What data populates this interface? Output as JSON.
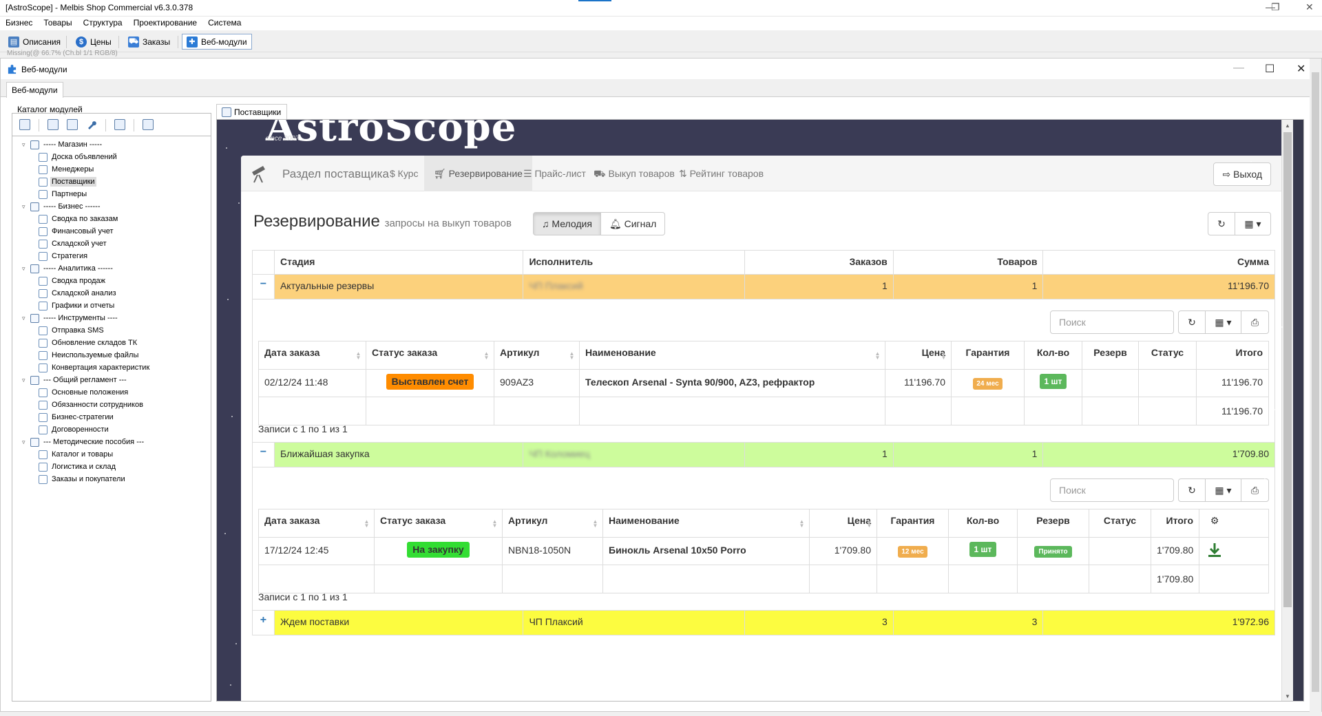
{
  "window": {
    "title": "[AstroScope] - Melbis Shop Commercial v6.3.0.378",
    "controls": [
      "—",
      "❐",
      "✕"
    ]
  },
  "menu": [
    "Бизнес",
    "Товары",
    "Структура",
    "Проектирование",
    "Система"
  ],
  "toolbar": {
    "items": [
      {
        "label": "Описания",
        "icon": "descriptions-icon",
        "color": "#4a7fc1"
      },
      {
        "label": "Цены",
        "icon": "dollar-icon",
        "color": "#2a6fc9"
      },
      {
        "label": "Заказы",
        "icon": "cart-icon",
        "color": "#3a7ed6"
      },
      {
        "label": "Веб-модули",
        "icon": "puzzle-icon",
        "color": "#2b7bd6"
      }
    ],
    "faint_text": "Missing(@ 66.7% (Ch.bl 1/1 RGB/8)"
  },
  "mdi": {
    "title": "Веб-модули",
    "outer_tab": "Веб-модули",
    "catalog_header": "Каталог модулей",
    "doc_tab": "Поставщики"
  },
  "tree": [
    {
      "label": "----- Магазин -----",
      "level": 1,
      "expanded": true
    },
    {
      "label": "Доска объявлений",
      "level": 2
    },
    {
      "label": "Менеджеры",
      "level": 2
    },
    {
      "label": "Поставщики",
      "level": 2,
      "selected": true
    },
    {
      "label": "Партнеры",
      "level": 2
    },
    {
      "label": "----- Бизнес ------",
      "level": 1,
      "expanded": true
    },
    {
      "label": "Сводка по заказам",
      "level": 2
    },
    {
      "label": "Финансовый учет",
      "level": 2
    },
    {
      "label": "Складской учет",
      "level": 2
    },
    {
      "label": "Стратегия",
      "level": 2
    },
    {
      "label": "----- Аналитика ------",
      "level": 1,
      "expanded": true
    },
    {
      "label": "Сводка продаж",
      "level": 2
    },
    {
      "label": "Складской анализ",
      "level": 2
    },
    {
      "label": "Графики и отчеты",
      "level": 2
    },
    {
      "label": "----- Инструменты ----",
      "level": 1,
      "expanded": true
    },
    {
      "label": "Отправка SMS",
      "level": 2
    },
    {
      "label": "Обновление складов ТК",
      "level": 2
    },
    {
      "label": "Неиспользуемые файлы",
      "level": 2
    },
    {
      "label": "Конвертация характеристик",
      "level": 2
    },
    {
      "label": "--- Общий регламент ---",
      "level": 1,
      "expanded": true
    },
    {
      "label": "Основные положения",
      "level": 2
    },
    {
      "label": "Обязанности сотрудников",
      "level": 2
    },
    {
      "label": "Бизнес-стратегии",
      "level": 2
    },
    {
      "label": "Договоренности",
      "level": 2
    },
    {
      "label": "--- Методические пособия ---",
      "level": 1,
      "expanded": true
    },
    {
      "label": "Каталог и товары",
      "level": 2
    },
    {
      "label": "Логистика и склад",
      "level": 2
    },
    {
      "label": "Заказы и покупатели",
      "level": 2
    }
  ],
  "web": {
    "logo": "AstroScope",
    "since": "since 2007",
    "brand": "Раздел поставщика",
    "nav": [
      {
        "label": "$ Курс",
        "active": false
      },
      {
        "label": "Резервирование",
        "active": true,
        "icon": "cart-icon"
      },
      {
        "label": "Прайс-лист",
        "active": false,
        "icon": "list-icon"
      },
      {
        "label": "Выкуп товаров",
        "active": false,
        "icon": "truck-icon"
      },
      {
        "label": "Рейтинг товаров",
        "active": false,
        "icon": "sort-icon"
      }
    ],
    "exit": "Выход",
    "section_title": "Резервирование",
    "section_sub": "запросы на выкуп товаров",
    "sound_buttons": [
      "Мелодия",
      "Сигнал"
    ],
    "columns": [
      "Стадия",
      "Исполнитель",
      "Заказов",
      "Товаров",
      "Сумма"
    ],
    "groups": [
      {
        "toggle": "−",
        "stage": "Актуальные резервы",
        "executor": "ЧП Плаксий",
        "orders": "1",
        "items": "1",
        "sum": "11'196.70",
        "color": "#fcd17c"
      },
      {
        "toggle": "−",
        "stage": "Ближайшая закупка",
        "executor": "ЧП Коломиец",
        "orders": "1",
        "items": "1",
        "sum": "1'709.80",
        "color": "#cdfc9c"
      },
      {
        "toggle": "+",
        "stage": "Ждем поставки",
        "executor": "ЧП Плаксий",
        "orders": "3",
        "items": "3",
        "sum": "1'972.96",
        "color": "#fcfc40"
      }
    ],
    "search_placeholder": "Поиск",
    "sub_columns": [
      "Дата заказа",
      "Статус заказа",
      "Артикул",
      "Наименование",
      "Цена",
      "Гарантия",
      "Кол-во",
      "Резерв",
      "Статус",
      "Итого"
    ],
    "sub1": {
      "date": "02/12/24 11:48",
      "status": "Выставлен счет",
      "status_color": "#ff8c00",
      "sku": "909AZ3",
      "name": "Телескоп Arsenal - Synta 90/900, AZ3, рефрактор",
      "price": "11'196.70",
      "warranty": "24 мес",
      "qty": "1 шт",
      "reserve": "",
      "state": "",
      "total": "11'196.70",
      "footer_total": "11'196.70",
      "info": "Записи с 1 по 1 из 1"
    },
    "sub2": {
      "date": "17/12/24 12:45",
      "status": "На закупку",
      "status_color": "#33dd33",
      "sku": "NBN18-1050N",
      "name": "Бинокль Arsenal 10x50 Porro",
      "price": "1'709.80",
      "warranty": "12 мес",
      "qty": "1 шт",
      "reserve": "Принято",
      "state": "",
      "total": "1'709.80",
      "footer_total": "1'709.80",
      "info": "Записи с 1 по 1 из 1"
    }
  }
}
